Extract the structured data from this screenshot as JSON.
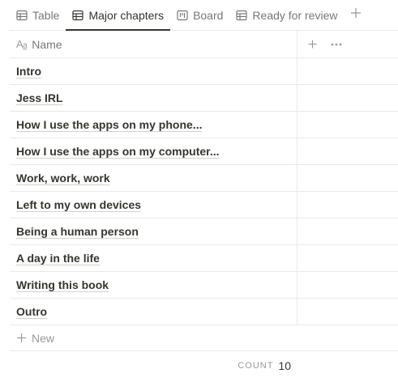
{
  "tabs": [
    {
      "label": "Table",
      "icon": "table-icon",
      "active": false
    },
    {
      "label": "Major chapters",
      "icon": "table-icon",
      "active": true
    },
    {
      "label": "Board",
      "icon": "board-icon",
      "active": false
    },
    {
      "label": "Ready for review",
      "icon": "table-icon",
      "active": false
    }
  ],
  "header": {
    "name_label": "Name",
    "name_icon": "text-property-icon",
    "add_property_icon": "plus-icon",
    "more_icon": "more-horizontal-icon"
  },
  "rows": [
    {
      "title": "Intro"
    },
    {
      "title": "Jess IRL"
    },
    {
      "title": "How I use the apps on my phone..."
    },
    {
      "title": "How I use the apps on my computer..."
    },
    {
      "title": "Work, work, work"
    },
    {
      "title": "Left to my own devices"
    },
    {
      "title": "Being a human person"
    },
    {
      "title": "A day in the life"
    },
    {
      "title": "Writing this book"
    },
    {
      "title": "Outro"
    }
  ],
  "new_row": {
    "label": "New"
  },
  "footer": {
    "count_label": "COUNT",
    "count_value": "10"
  },
  "colors": {
    "text": "#37352f",
    "muted": "#787774",
    "border": "#e9e9e7"
  }
}
